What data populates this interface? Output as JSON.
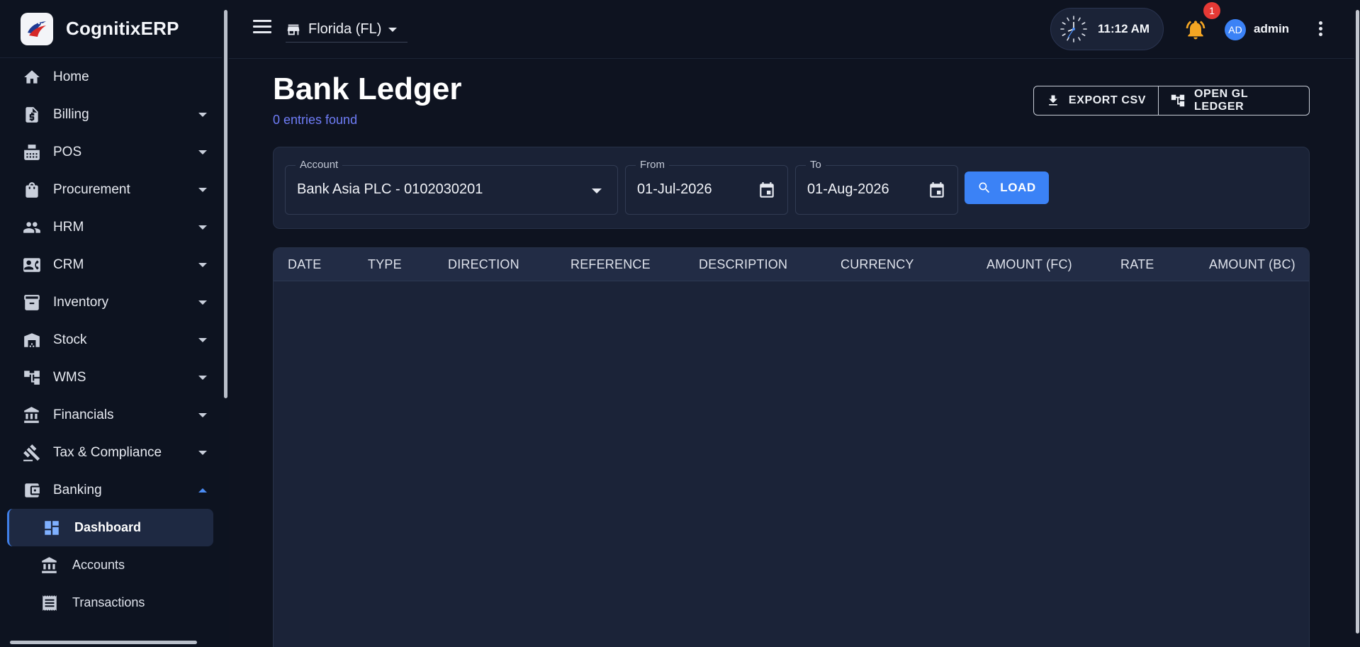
{
  "app": {
    "name": "CognitixERP"
  },
  "sidebar": {
    "items": [
      {
        "label": "Home",
        "icon": "home-icon"
      },
      {
        "label": "Billing",
        "icon": "billing-icon"
      },
      {
        "label": "POS",
        "icon": "pos-icon"
      },
      {
        "label": "Procurement",
        "icon": "shopping-bag-icon"
      },
      {
        "label": "HRM",
        "icon": "people-icon"
      },
      {
        "label": "CRM",
        "icon": "contact-card-icon"
      },
      {
        "label": "Inventory",
        "icon": "archive-icon"
      },
      {
        "label": "Stock",
        "icon": "warehouse-icon"
      },
      {
        "label": "WMS",
        "icon": "hierarchy-icon"
      },
      {
        "label": "Financials",
        "icon": "bank-icon"
      },
      {
        "label": "Tax & Compliance",
        "icon": "gavel-icon"
      },
      {
        "label": "Banking",
        "icon": "wallet-icon"
      }
    ],
    "banking_sub": [
      {
        "label": "Dashboard",
        "icon": "dashboard-icon"
      },
      {
        "label": "Accounts",
        "icon": "bank-icon"
      },
      {
        "label": "Transactions",
        "icon": "receipt-icon"
      }
    ]
  },
  "topbar": {
    "store": "Florida (FL)",
    "time": "11:12 AM",
    "notification_count": "1",
    "avatar_initials": "AD",
    "username": "admin"
  },
  "page": {
    "title": "Bank Ledger",
    "entries": "0 entries found",
    "export_label": "EXPORT CSV",
    "open_gl_label": "OPEN GL LEDGER"
  },
  "filters": {
    "account_label": "Account",
    "account_value": "Bank Asia PLC - 0102030201",
    "from_label": "From",
    "from_value": "01-Jul-2026",
    "to_label": "To",
    "to_value": "01-Aug-2026",
    "load_label": "LOAD"
  },
  "table": {
    "columns": [
      "DATE",
      "TYPE",
      "DIRECTION",
      "REFERENCE",
      "DESCRIPTION",
      "CURRENCY",
      "AMOUNT (FC)",
      "RATE",
      "AMOUNT (BC)"
    ],
    "rows": []
  },
  "colors": {
    "accent": "#3b82f6",
    "badge": "#e53935",
    "bell": "#f5a623",
    "link": "#6f7df7"
  }
}
